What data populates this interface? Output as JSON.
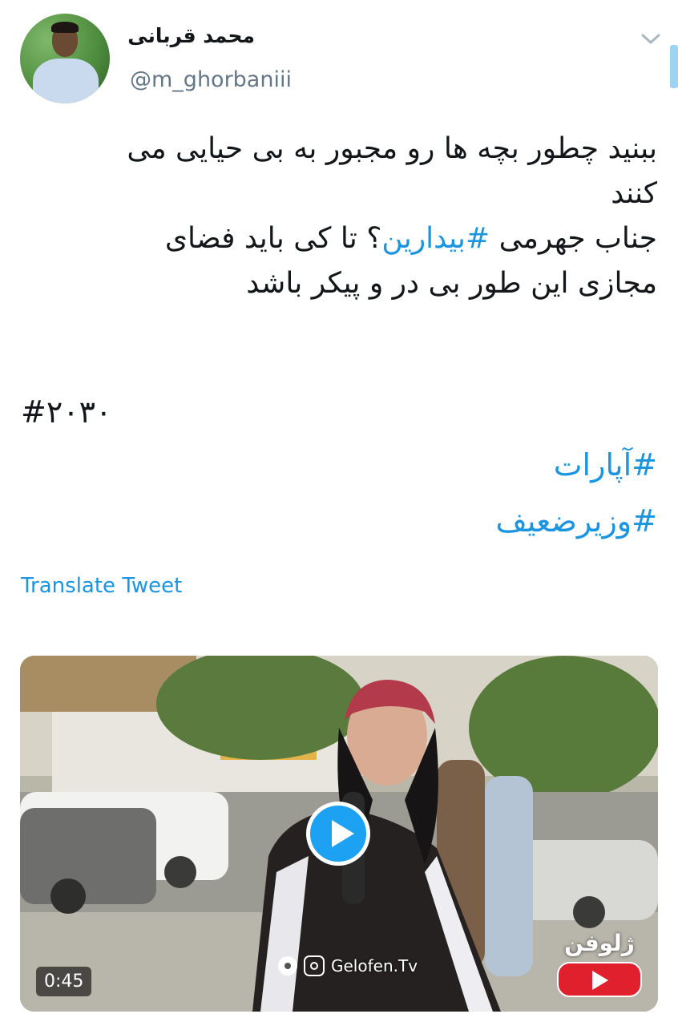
{
  "author": {
    "display_name": "محمد قربانی",
    "username": "@m_ghorbaniii"
  },
  "tweet": {
    "lines": [
      "ببنید چطور بچه ها رو مجبور به بی حیایی می",
      "کنند",
      "مجازی این طور بی در و پیکر باشد"
    ],
    "line3_before": "جناب جهرمی ",
    "line3_hashtag": "#بیدارین",
    "line3_after": "؟ تا کی باید فضای",
    "hashtag_2030": "#۲۰۳۰",
    "hashtags": [
      "#آپارات",
      "#وزیرضعیف"
    ]
  },
  "translate_label": "Translate Tweet",
  "video": {
    "duration": "0:45",
    "watermark": "Gelofen.Tv",
    "brand": "ژلوفن"
  },
  "colors": {
    "link": "#1b95e0",
    "text": "#14171a",
    "secondary": "#657786",
    "play": "#1da1f2"
  }
}
